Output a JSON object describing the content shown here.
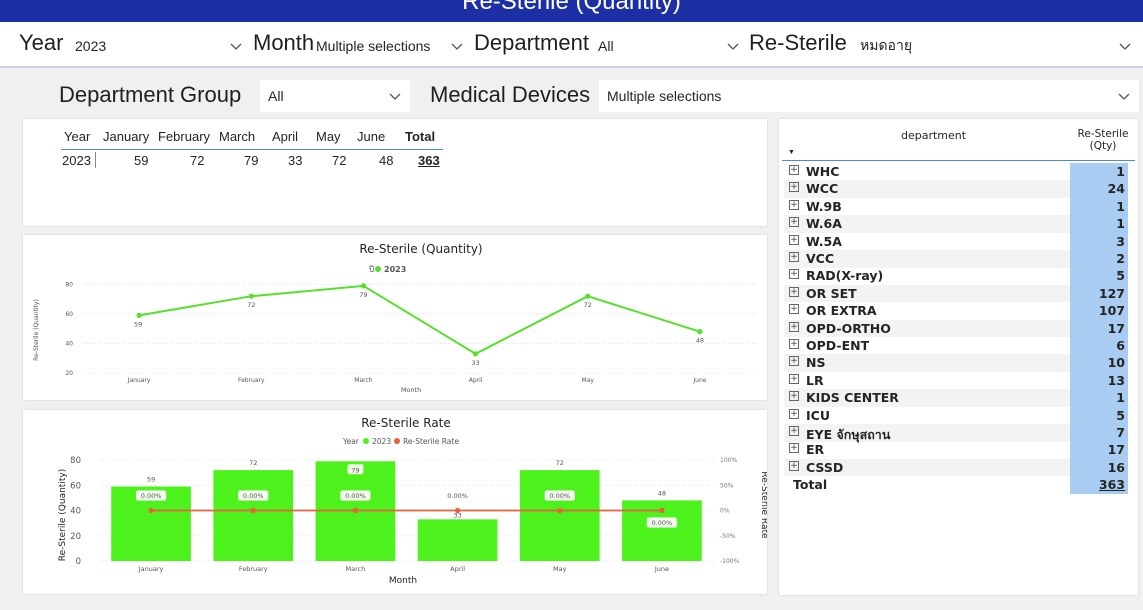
{
  "page_title": "Re-Sterile (Quantity)",
  "filters": {
    "year_label": "Year",
    "year_value": "2023",
    "month_label": "Month",
    "month_value": "Multiple selections",
    "department_label": "Department",
    "department_value": "All",
    "resterile_label": "Re-Sterile",
    "resterile_value": "หมดอายุ",
    "dept_group_label": "Department Group",
    "dept_group_value": "All",
    "medical_devices_label": "Medical Devices",
    "medical_devices_value": "Multiple selections"
  },
  "matrix": {
    "headers": [
      "Year",
      "January",
      "February",
      "March",
      "April",
      "May",
      "June",
      "Total"
    ],
    "row": [
      "2023",
      "59",
      "72",
      "79",
      "33",
      "72",
      "48",
      "363"
    ]
  },
  "line_chart": {
    "title": "Re-Sterile (Quantity)",
    "legend_label": "ปี",
    "legend_series": "2023",
    "xlabel": "Month",
    "ylabel": "Re-Sterile (Quantity)",
    "yticks": [
      "80",
      "60",
      "40",
      "20"
    ]
  },
  "combo_chart": {
    "title": "Re-Sterile Rate",
    "legend_label": "Year",
    "legend_series1": "2023",
    "legend_series2": "Re-Sterile Rate",
    "xlabel": "Month",
    "ylabel_left": "Re-Sterile (Quantity)",
    "ylabel_right": "Re-Sterile Rate",
    "yticks_left": [
      "80",
      "60",
      "40",
      "20",
      "0"
    ],
    "yticks_right": [
      "100%",
      "50%",
      "0%",
      "-50%",
      "-100%"
    ],
    "rate_labels": [
      "0.00%",
      "0.00%",
      "0.00%",
      "0.00%",
      "0.00%",
      "0.00%"
    ]
  },
  "dept_table": {
    "col1": "department",
    "col2_line1": "Re-Sterile",
    "col2_line2": "(Qty)",
    "rows": [
      {
        "name": "WHC",
        "qty": "1"
      },
      {
        "name": "WCC",
        "qty": "24"
      },
      {
        "name": "W.9B",
        "qty": "1"
      },
      {
        "name": "W.6A",
        "qty": "1"
      },
      {
        "name": "W.5A",
        "qty": "3"
      },
      {
        "name": "VCC",
        "qty": "2"
      },
      {
        "name": "RAD(X-ray)",
        "qty": "5"
      },
      {
        "name": "OR SET",
        "qty": "127"
      },
      {
        "name": "OR EXTRA",
        "qty": "107"
      },
      {
        "name": "OPD-ORTHO",
        "qty": "17"
      },
      {
        "name": "OPD-ENT",
        "qty": "6"
      },
      {
        "name": "NS",
        "qty": "10"
      },
      {
        "name": "LR",
        "qty": "13"
      },
      {
        "name": "KIDS CENTER",
        "qty": "1"
      },
      {
        "name": "ICU",
        "qty": "5"
      },
      {
        "name": "EYE จักษุสถาน",
        "qty": "7"
      },
      {
        "name": "ER",
        "qty": "17"
      },
      {
        "name": "CSSD",
        "qty": "16"
      }
    ],
    "total_label": "Total",
    "total_value": "363"
  },
  "chart_data": [
    {
      "type": "line",
      "title": "Re-Sterile (Quantity)",
      "xlabel": "Month",
      "ylabel": "Re-Sterile (Quantity)",
      "categories": [
        "January",
        "February",
        "March",
        "April",
        "May",
        "June"
      ],
      "series": [
        {
          "name": "2023",
          "values": [
            59,
            72,
            79,
            33,
            72,
            48
          ],
          "color": "#55e02a"
        }
      ],
      "ylim": [
        20,
        85
      ],
      "legend": "top-center"
    },
    {
      "type": "bar",
      "title": "Re-Sterile Rate",
      "xlabel": "Month",
      "ylabel": "Re-Sterile (Quantity)",
      "categories": [
        "January",
        "February",
        "March",
        "April",
        "May",
        "June"
      ],
      "series": [
        {
          "name": "2023",
          "values": [
            59,
            72,
            79,
            33,
            72,
            48
          ],
          "color": "#4df21c"
        },
        {
          "name": "Re-Sterile Rate",
          "values": [
            0,
            0,
            0,
            0,
            0,
            0
          ],
          "color": "#e8603c",
          "axis": "right"
        }
      ],
      "ylim": [
        0,
        80
      ],
      "y2lim": [
        -100,
        100
      ],
      "legend": "top-center"
    }
  ]
}
